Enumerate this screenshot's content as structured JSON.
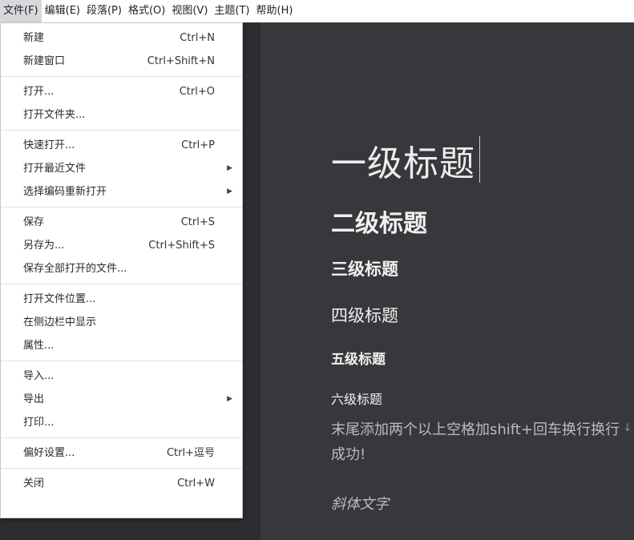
{
  "menubar": {
    "items": [
      "文件(F)",
      "编辑(E)",
      "段落(P)",
      "格式(O)",
      "视图(V)",
      "主题(T)",
      "帮助(H)"
    ]
  },
  "file_menu": {
    "groups": [
      [
        {
          "label": "新建",
          "shortcut": "Ctrl+N"
        },
        {
          "label": "新建窗口",
          "shortcut": "Ctrl+Shift+N"
        }
      ],
      [
        {
          "label": "打开...",
          "shortcut": "Ctrl+O"
        },
        {
          "label": "打开文件夹...",
          "shortcut": ""
        }
      ],
      [
        {
          "label": "快速打开...",
          "shortcut": "Ctrl+P"
        },
        {
          "label": "打开最近文件",
          "shortcut": "",
          "submenu": true
        },
        {
          "label": "选择编码重新打开",
          "shortcut": "",
          "submenu": true
        }
      ],
      [
        {
          "label": "保存",
          "shortcut": "Ctrl+S"
        },
        {
          "label": "另存为...",
          "shortcut": "Ctrl+Shift+S"
        },
        {
          "label": "保存全部打开的文件...",
          "shortcut": ""
        }
      ],
      [
        {
          "label": "打开文件位置...",
          "shortcut": ""
        },
        {
          "label": "在侧边栏中显示",
          "shortcut": ""
        },
        {
          "label": "属性...",
          "shortcut": ""
        }
      ],
      [
        {
          "label": "导入...",
          "shortcut": ""
        },
        {
          "label": "导出",
          "shortcut": "",
          "submenu": true
        },
        {
          "label": "打印...",
          "shortcut": ""
        }
      ],
      [
        {
          "label": "偏好设置...",
          "shortcut": "Ctrl+逗号"
        }
      ],
      [
        {
          "label": "关闭",
          "shortcut": "Ctrl+W"
        }
      ]
    ]
  },
  "editor": {
    "h1": "一级标题",
    "h2": "二级标题",
    "h3": "三级标题",
    "h4": "四级标题",
    "h5": "五级标题",
    "h6": "六级标题",
    "paragraph": "末尾添加两个以上空格加shift+回车换行换行成功!",
    "italic": "斜体文字",
    "return_mark": "↓"
  },
  "colors": {
    "editor_bg": "#36383b",
    "menu_bg": "#ffffff",
    "menubar_active": "#d6d8db"
  }
}
